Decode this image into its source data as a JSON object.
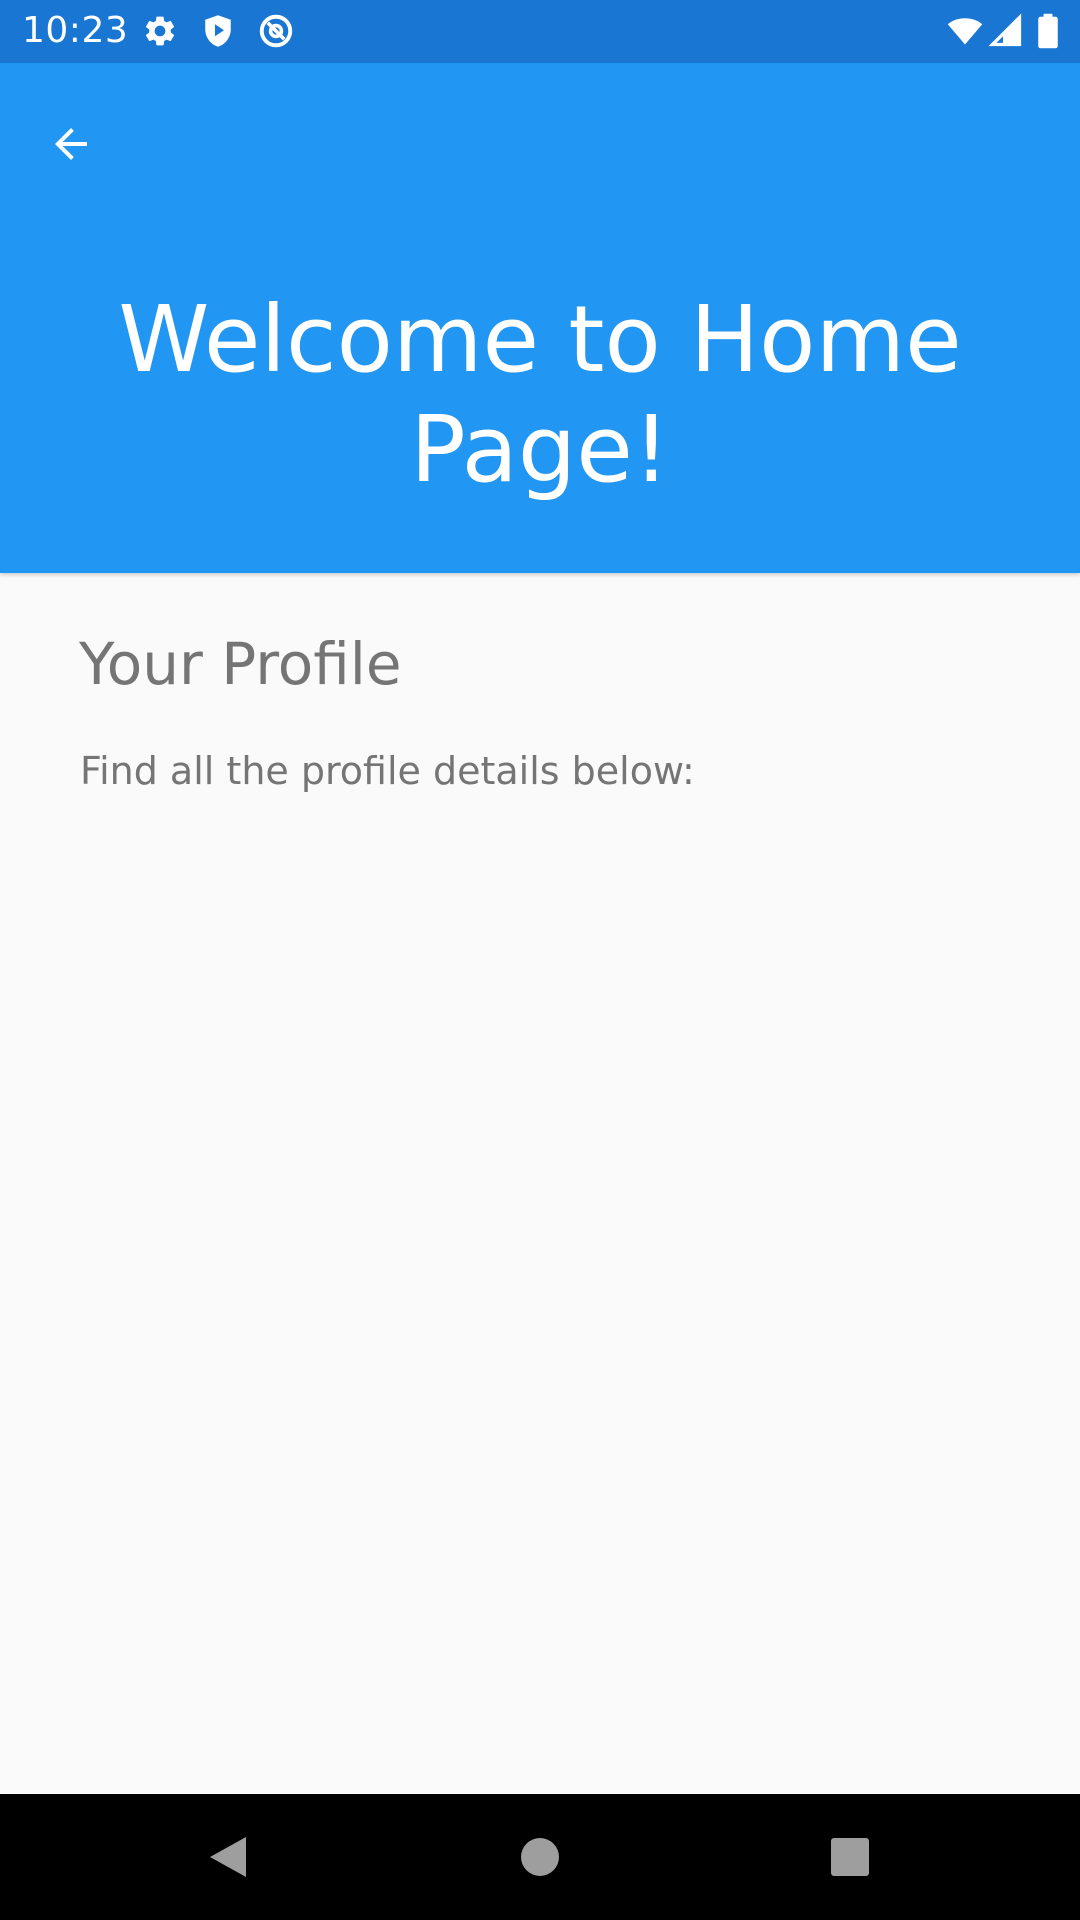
{
  "status_bar": {
    "time": "10:23",
    "left_icons": [
      "gear-icon",
      "shield-play-icon",
      "at-sign-icon"
    ],
    "right_icons": [
      "wifi-icon",
      "cell-signal-icon",
      "battery-icon"
    ]
  },
  "header": {
    "back_icon": "arrow-back-icon",
    "title": "Welcome to Home Page!"
  },
  "profile": {
    "heading": "Your Profile",
    "description": "Find all the profile details below:"
  },
  "nav_bar": {
    "buttons": [
      "back-triangle-icon",
      "home-circle-icon",
      "recents-square-icon"
    ]
  },
  "colors": {
    "status_bar": "#1976d2",
    "app_bar": "#2196f3",
    "background": "#fafafa",
    "text_secondary": "#757575",
    "nav_bar": "#000000"
  }
}
